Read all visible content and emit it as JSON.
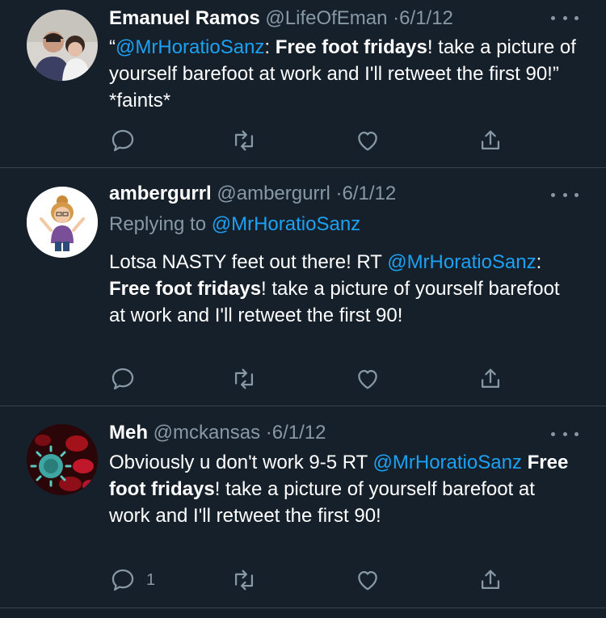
{
  "tweets": [
    {
      "name": "Emanuel Ramos",
      "handle": "@LifeOfEman",
      "sep": "·",
      "date": "6/1/12",
      "avatar": "avatar-man-holding-baby",
      "replying_label": "",
      "replying_to": "",
      "body": {
        "prefix": "“",
        "mention": "@MrHoratioSanz",
        "colon": ": ",
        "bold": "Free foot fridays",
        "rest": "! take a picture of yourself barefoot at work and I'll retweet the first 90!” *faints*"
      },
      "reply_count": ""
    },
    {
      "name": "ambergurrl",
      "handle": "@ambergurrl",
      "sep": "·",
      "date": "6/1/12",
      "avatar": "avatar-cartoon-woman",
      "replying_label": "Replying to ",
      "replying_to": "@MrHoratioSanz",
      "body": {
        "prefix": "Lotsa NASTY feet out there! RT ",
        "mention": "@MrHoratioSanz",
        "colon": ": ",
        "bold": "Free foot fridays",
        "rest": "! take a picture of yourself barefoot at work and I'll retweet the first 90!"
      },
      "reply_count": ""
    },
    {
      "name": "Meh",
      "handle": "@mckansas",
      "sep": "·",
      "date": "6/1/12",
      "avatar": "avatar-virus-cells",
      "replying_label": "",
      "replying_to": "",
      "body": {
        "prefix": "Obviously u don't work 9-5 RT ",
        "mention": "@MrHoratioSanz",
        "colon": " ",
        "bold": "Free foot fridays",
        "rest": "! take a picture of yourself barefoot at work and I'll retweet the first 90!"
      },
      "reply_count": "1"
    }
  ],
  "colors": {
    "background": "#15202b",
    "accent": "#1da1f2",
    "secondary": "#8899a6",
    "divider": "#38444d"
  }
}
